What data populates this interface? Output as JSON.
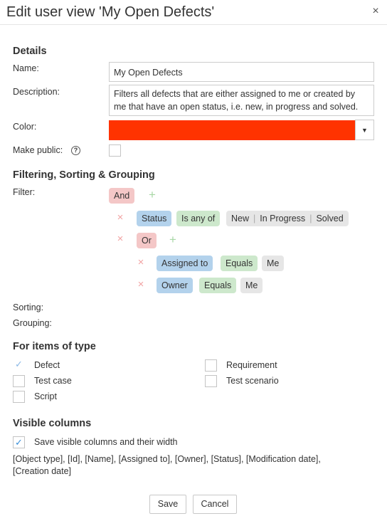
{
  "dialog": {
    "title": "Edit user view 'My Open Defects'",
    "close_glyph": "×"
  },
  "details": {
    "heading": "Details",
    "name_label": "Name:",
    "name_value": "My Open Defects",
    "description_label": "Description:",
    "description_value": "Filters all defects that are either assigned to me or created by me that have an open status, i.e. new, in progress and solved.",
    "color_label": "Color:",
    "color_value": "#ff3300",
    "public_label": "Make public:",
    "public_checked": false
  },
  "filtering": {
    "heading": "Filtering, Sorting & Grouping",
    "filter_label": "Filter:",
    "root_operator": "And",
    "status": {
      "field": "Status",
      "comparator": "Is any of",
      "values": [
        "New",
        "In Progress",
        "Solved"
      ]
    },
    "or_operator": "Or",
    "assigned": {
      "field": "Assigned to",
      "comparator": "Equals",
      "value": "Me"
    },
    "owner": {
      "field": "Owner",
      "comparator": "Equals",
      "value": "Me"
    },
    "sorting_label": "Sorting:",
    "grouping_label": "Grouping:"
  },
  "item_types": {
    "heading": "For items of type",
    "items": [
      {
        "label": "Defect",
        "checked": true
      },
      {
        "label": "Requirement",
        "checked": false
      },
      {
        "label": "Test case",
        "checked": false
      },
      {
        "label": "Test scenario",
        "checked": false
      },
      {
        "label": "Script",
        "checked": false
      }
    ]
  },
  "columns": {
    "heading": "Visible columns",
    "save_label": "Save visible columns and their width",
    "save_checked": true,
    "list_line1": "[Object type], [Id], [Name], [Assigned to], [Owner], [Status], [Modification date],",
    "list_line2": "[Creation date]"
  },
  "buttons": {
    "save": "Save",
    "cancel": "Cancel"
  },
  "icons": {
    "delete": "delete-x-icon",
    "add": "add-plus-icon",
    "help": "help-circle-icon",
    "dropdown": "caret-down-icon",
    "check": "checkmark-icon"
  },
  "colors": {
    "and_or_chip": "#f4c7c7",
    "field_chip": "#b3d2ec",
    "comparator_chip": "#cde8cc",
    "value_chip": "#e6e6e6"
  }
}
